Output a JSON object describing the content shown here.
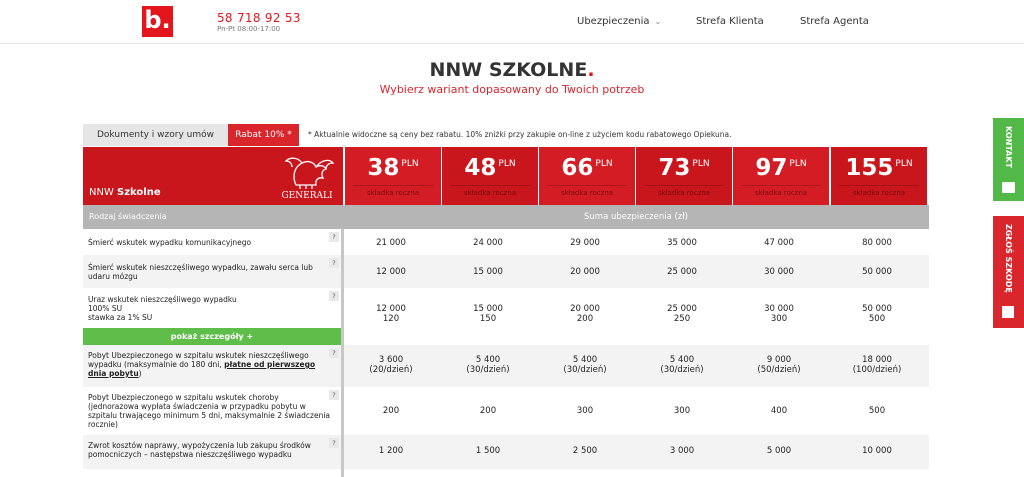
{
  "header": {
    "logo_text": "b.",
    "phone": "58 718 92 53",
    "hours": "Pn-Pt 08:00-17:00",
    "nav": [
      {
        "label": "Ubezpieczenia"
      },
      {
        "label": "Strefa Klienta"
      },
      {
        "label": "Strefa Agenta"
      }
    ]
  },
  "page": {
    "title": "NNW SZKOLNE",
    "title_dot": ".",
    "subtitle": "Wybierz wariant dopasowany do Twoich potrzeb"
  },
  "tabs": {
    "documents": "Dokumenty i wzory umów",
    "discount": "Rabat 10% *",
    "note": "* Aktualnie widoczne są ceny bez rabatu. 10% zniżki przy zakupie on-line z użyciem kodu rabatowego Opiekuna."
  },
  "table": {
    "product_prefix": "NNW ",
    "product_name": "Szkolne",
    "insurer_logo_text": "GENERALI",
    "currency": "PLN",
    "price_caption": "składka roczna",
    "prices": [
      "38",
      "48",
      "66",
      "73",
      "97",
      "155"
    ],
    "price_colors": [
      "#d41c24",
      "#c9161d",
      "#d41c24",
      "#c9161d",
      "#d41c24",
      "#c9161d"
    ],
    "col_header_left": "Rodzaj świadczenia",
    "col_header_right": "Suma ubezpieczenia (zł)",
    "help_mark": "?",
    "show_details": "pokaż szczegóły +",
    "rows": [
      {
        "label": "Śmierć wskutek wypadku komunikacyjnego",
        "values": [
          "21 000",
          "24 000",
          "29 000",
          "35 000",
          "47 000",
          "80 000"
        ]
      },
      {
        "label": "Śmierć wskutek nieszczęśliwego wypadku, zawału serca lub udaru mózgu",
        "values": [
          "12 000",
          "15 000",
          "20 000",
          "25 000",
          "30 000",
          "50 000"
        ]
      },
      {
        "label_lines": [
          "Uraz wskutek nieszczęśliwego wypadku",
          "100% SU",
          "stawka za 1% SU"
        ],
        "values": [
          "12 000",
          "15 000",
          "20 000",
          "25 000",
          "30 000",
          "50 000"
        ],
        "values2": [
          "120",
          "150",
          "200",
          "250",
          "300",
          "500"
        ]
      },
      {
        "label": "Pobyt Ubezpieczonego w szpitalu wskutek nieszczęśliwego wypadku (maksymalnie do 180 dni, ",
        "label_link": "płatne od pierwszego dnia pobytu",
        "label_end": ")",
        "values": [
          "3 600",
          "5 400",
          "5 400",
          "5 400",
          "9 000",
          "18 000"
        ],
        "values2": [
          "(20/dzień)",
          "(30/dzień)",
          "(30/dzień)",
          "(30/dzień)",
          "(50/dzień)",
          "(100/dzień)"
        ]
      },
      {
        "label": "Pobyt Ubezpieczonego w szpitalu wskutek choroby (jednorazowa wypłata świadczenia w przypadku pobytu w szpitalu trwającego minimum 5 dni, maksymalnie 2 świadczenia rocznie)",
        "values": [
          "200",
          "200",
          "300",
          "300",
          "400",
          "500"
        ]
      },
      {
        "label": "Zwrot kosztów naprawy, wypożyczenia lub zakupu środków pomocniczych – następstwa nieszczęśliwego wypadku",
        "values": [
          "1 200",
          "1 500",
          "2 500",
          "3 000",
          "5 000",
          "10 000"
        ]
      }
    ]
  },
  "side": {
    "contact": "KONTAKT",
    "report": "ZGŁOŚ SZKODĘ"
  },
  "colors": {
    "brand_red": "#e3161e",
    "green": "#52b848",
    "header_gray": "#b5b5b5"
  }
}
